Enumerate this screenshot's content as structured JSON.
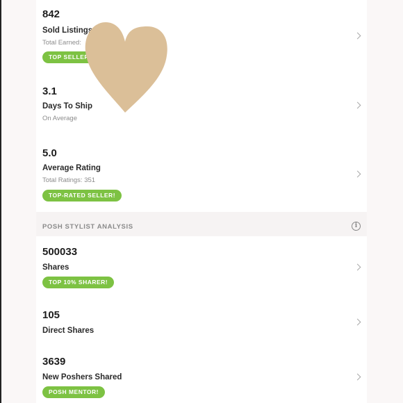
{
  "seller_stats": {
    "sold_listings": {
      "value": "842",
      "label": "Sold Listings",
      "sub": "Total Earned:",
      "badge": "TOP SELLER"
    },
    "days_to_ship": {
      "value": "3.1",
      "label": "Days To Ship",
      "sub": "On Average"
    },
    "average_rating": {
      "value": "5.0",
      "label": "Average Rating",
      "sub": "Total Ratings: 351",
      "badge": "TOP-RATED SELLER!"
    }
  },
  "stylist_section": {
    "title": "POSH STYLIST ANALYSIS",
    "info_icon": "info-icon"
  },
  "stylist_stats": {
    "shares": {
      "value": "500033",
      "label": "Shares",
      "badge": "TOP 10% SHARER!"
    },
    "direct_shares": {
      "value": "105",
      "label": "Direct Shares"
    },
    "new_poshers": {
      "value": "3639",
      "label": "New Poshers Shared",
      "badge": "POSH MENTOR!"
    }
  },
  "colors": {
    "badge_green": "#7dc243",
    "heart_overlay": "#dbbf98"
  }
}
